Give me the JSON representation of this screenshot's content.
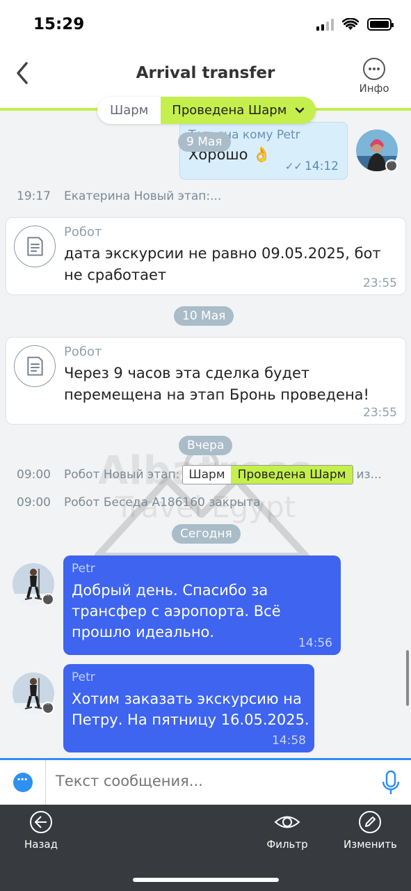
{
  "status_bar": {
    "time": "15:29"
  },
  "header": {
    "title": "Arrival transfer",
    "info_label": "Инфо"
  },
  "stage": {
    "previous": "Шарм",
    "current": "Проведена Шарм"
  },
  "watermark": {
    "line1": "Albatross",
    "line2": "Travel Egypt"
  },
  "messages": {
    "outgoing": {
      "sender": "Татьяна кому Petr",
      "text": "Хорошо 👌",
      "time": "14:12"
    },
    "date_may9": "9 Мая",
    "event1": {
      "time": "19:17",
      "text": "Екатерина Новый этап:..."
    },
    "robot1": {
      "name": "Робот",
      "text": "дата экскурсии не равно 09.05.2025, бот не сработает",
      "time": "23:55"
    },
    "date_may10": "10 Мая",
    "robot2": {
      "name": "Робот",
      "text": "Через 9 часов эта сделка будет перемещена на этап Бронь проведена!",
      "time": "23:55"
    },
    "date_yesterday": "Вчера",
    "event2": {
      "time": "09:00",
      "prefix": "Робот Новый этап:",
      "stage_prev": "Шарм",
      "stage_cur": "Проведена Шарм",
      "suffix": "из..."
    },
    "event3": {
      "time": "09:00",
      "text": "Робот Беседа A186160 закрыта"
    },
    "date_today": "Сегодня",
    "incoming1": {
      "sender": "Petr",
      "text": "Добрый день. Спасибо за трансфер с аэропорта.  Всё прошло идеально.",
      "time": "14:56"
    },
    "incoming2": {
      "sender": "Petr",
      "text": "Хотим заказать экскурсию на Петру. На пятницу 16.05.2025.",
      "time": "14:58"
    }
  },
  "input": {
    "placeholder": "Текст сообщения..."
  },
  "toolbar": {
    "back": "Назад",
    "filter": "Фильтр",
    "edit": "Изменить"
  },
  "colors": {
    "accent_green": "#c4ef4c",
    "bubble_blue": "#3e64f0",
    "input_blue": "#2f8ff2",
    "toolbar_bg": "#373a3e"
  }
}
